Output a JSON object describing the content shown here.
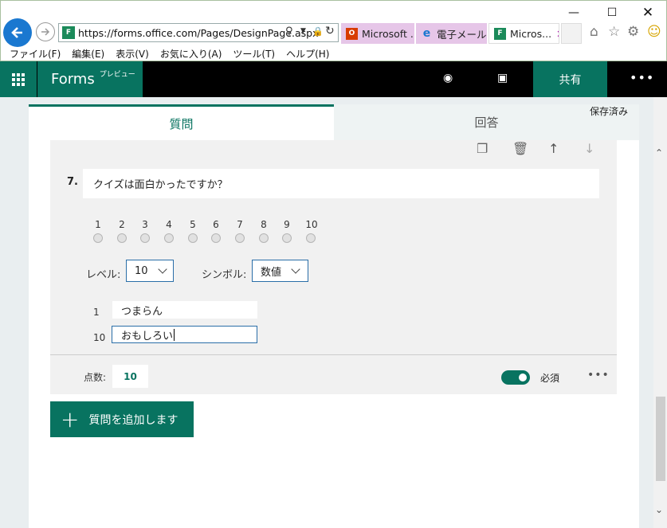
{
  "browser": {
    "url": "https://forms.office.com/Pages/DesignPage.aspx",
    "tabs": [
      {
        "label": "Microsoft ...",
        "icon": "office-icon",
        "color": "#d83b01"
      },
      {
        "label": "電子メール...",
        "icon": "ie-icon",
        "color": "#1a78d0"
      },
      {
        "label": "Micros...",
        "icon": "forms-icon",
        "color": "#1b8a5a"
      }
    ],
    "menu": [
      "ファイル(F)",
      "編集(E)",
      "表示(V)",
      "お気に入り(A)",
      "ツール(T)",
      "ヘルプ(H)"
    ]
  },
  "header": {
    "app_name": "Forms",
    "preview_badge": "プレビュー",
    "share_label": "共有",
    "accent": "#087360"
  },
  "tabs": {
    "questions": "質問",
    "responses": "回答",
    "saved_status": "保存済み"
  },
  "question": {
    "number": "7.",
    "title": "クイズは面白かったですか？",
    "rating_values": [
      "1",
      "2",
      "3",
      "4",
      "5",
      "6",
      "7",
      "8",
      "9",
      "10"
    ],
    "level_label": "レベル:",
    "level_value": "10",
    "symbol_label": "シンボル:",
    "symbol_value": "数値",
    "low_end": {
      "number": "1",
      "label": "つまらん"
    },
    "high_end": {
      "number": "10",
      "label": "おもしろい"
    },
    "points_label": "点数:",
    "points_value": "10",
    "required_label": "必須",
    "required": true
  },
  "add_question_label": "質問を追加します"
}
